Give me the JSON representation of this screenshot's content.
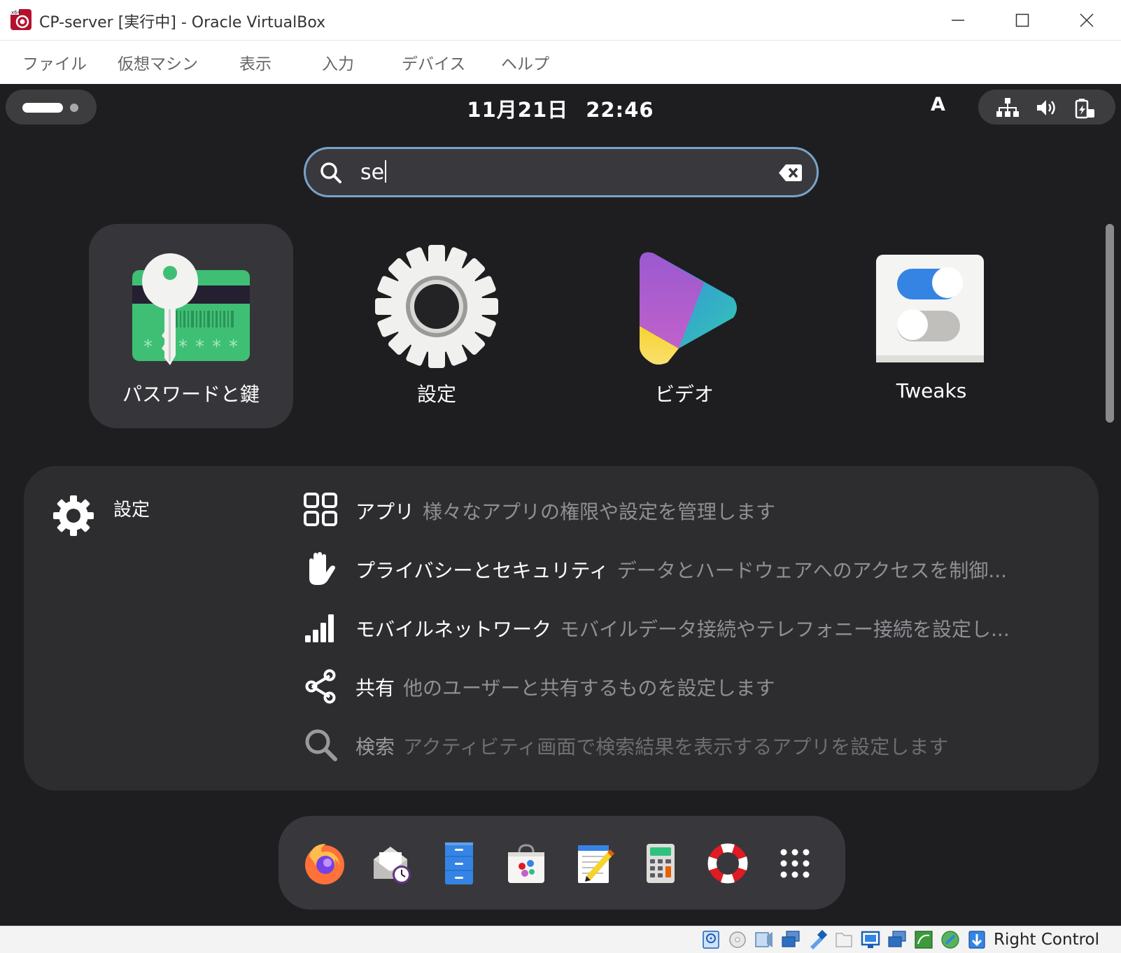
{
  "window": {
    "title": "CP-server [実行中] - Oracle VirtualBox",
    "minimize": "minimize",
    "maximize": "maximize",
    "close": "close"
  },
  "menubar": {
    "items": [
      "ファイル",
      "仮想マシン",
      "表示",
      "入力",
      "デバイス",
      "ヘルプ"
    ]
  },
  "topbar": {
    "date": "11月21日",
    "time": "22:46",
    "input_method": "A",
    "status_icons": [
      "network-wired-icon",
      "volume-icon",
      "battery-icon"
    ]
  },
  "search": {
    "query": "se"
  },
  "apps": [
    {
      "label": "パスワードと鍵",
      "icon": "passwords-keys-icon",
      "selected": true
    },
    {
      "label": "設定",
      "icon": "settings-gear-icon",
      "selected": false
    },
    {
      "label": "ビデオ",
      "icon": "videos-icon",
      "selected": false
    },
    {
      "label": "Tweaks",
      "icon": "tweaks-icon",
      "selected": false
    }
  ],
  "results": {
    "provider": "設定",
    "provider_icon": "settings-gear-icon",
    "items": [
      {
        "title": "アプリ",
        "description": "様々なアプリの権限や設定を管理します",
        "icon": "apps-grid-icon"
      },
      {
        "title": "プライバシーとセキュリティ",
        "description": "データとハードウェアへのアクセスを制御...",
        "icon": "privacy-hand-icon"
      },
      {
        "title": "モバイルネットワーク",
        "description": "モバイルデータ接続やテレフォニー接続を設定し...",
        "icon": "signal-bars-icon"
      },
      {
        "title": "共有",
        "description": "他のユーザーと共有するものを設定します",
        "icon": "share-icon"
      },
      {
        "title": "検索",
        "description": "アクティビティ画面で検索結果を表示するアプリを設定します",
        "icon": "search-icon"
      }
    ]
  },
  "dock": {
    "items": [
      "firefox-icon",
      "evolution-mail-icon",
      "files-icon",
      "software-icon",
      "text-editor-icon",
      "calculator-icon",
      "help-icon",
      "show-apps-icon"
    ]
  },
  "statusbar": {
    "host_key": "Right Control",
    "icons": [
      "hard-disk-icon",
      "optical-drive-icon",
      "audio-icon",
      "network-icon",
      "usb-icon",
      "shared-folder-icon",
      "display-icon",
      "video-capture-icon",
      "guest-additions-icon",
      "cpu-icon",
      "mouse-integration-icon"
    ]
  }
}
